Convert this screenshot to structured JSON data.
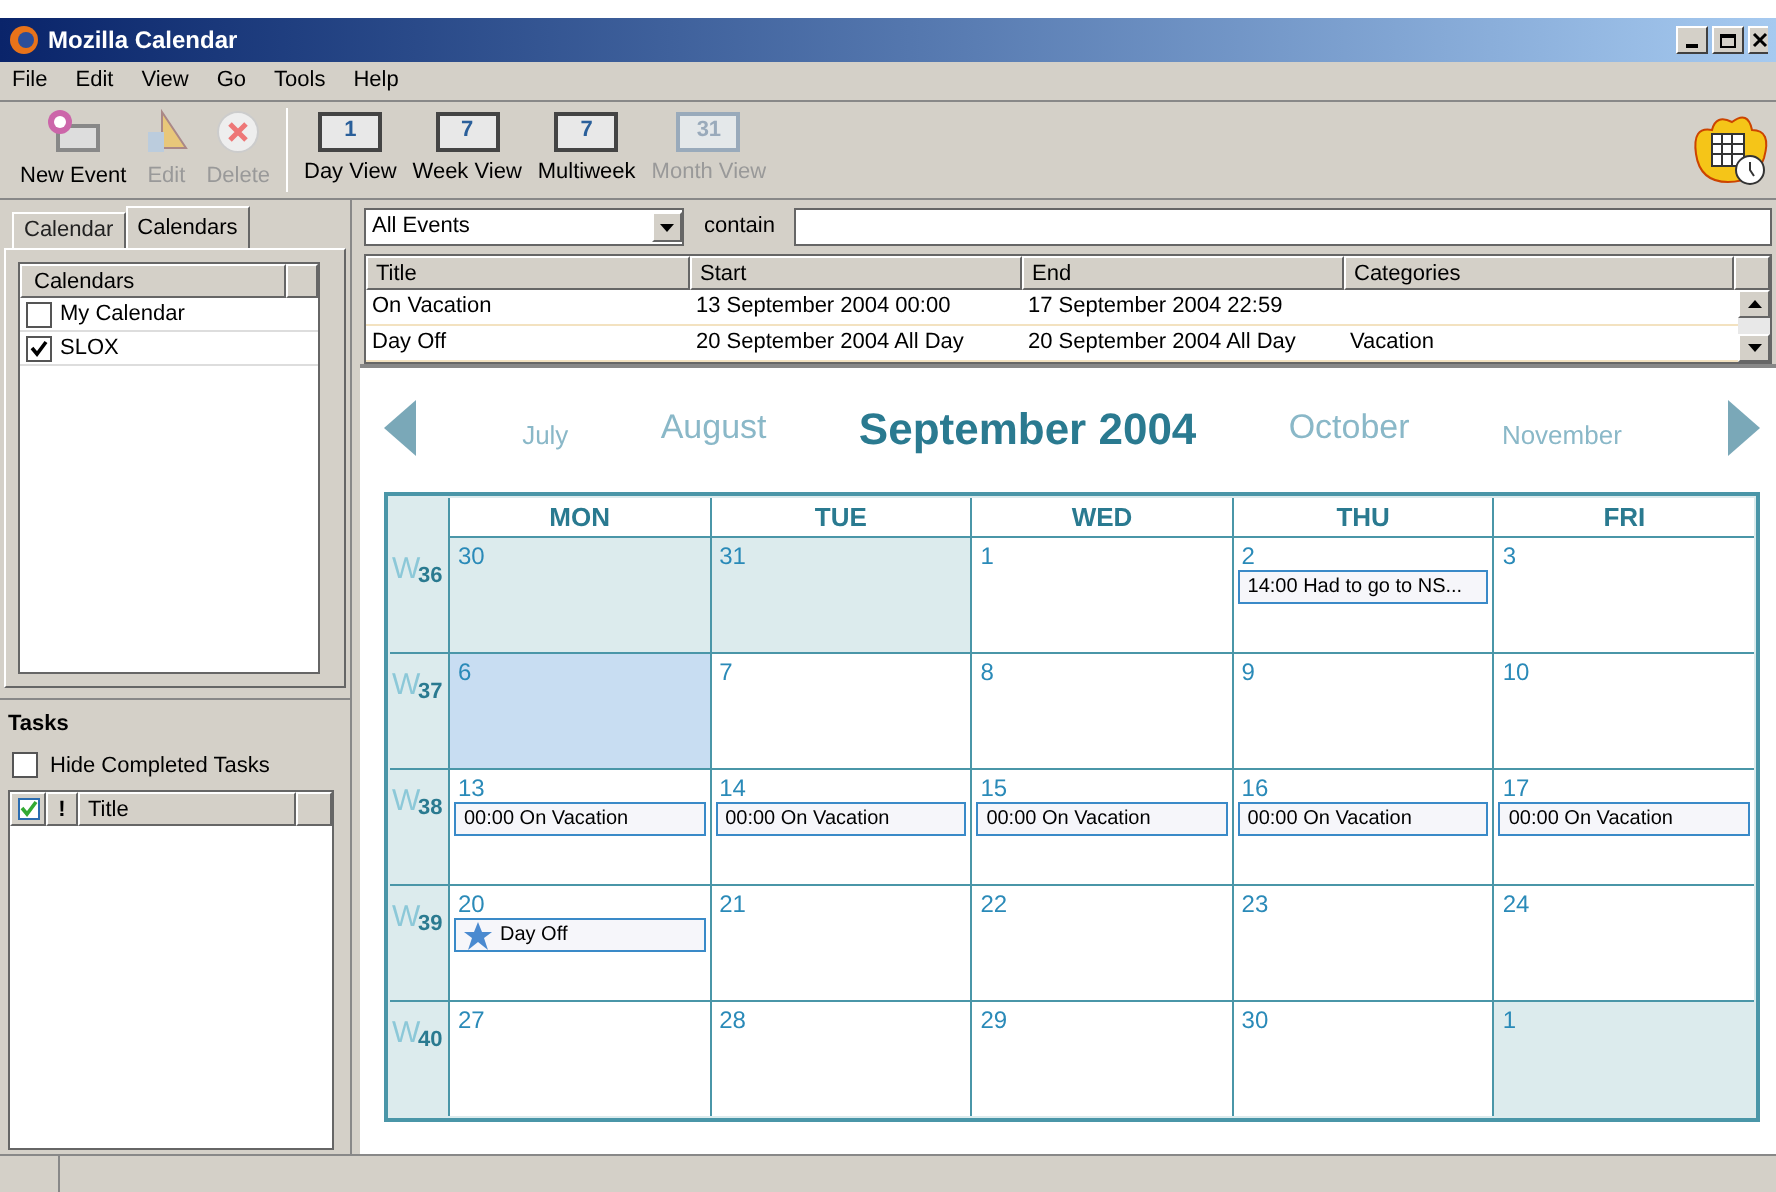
{
  "window": {
    "title": "Mozilla Calendar"
  },
  "menu": [
    "File",
    "Edit",
    "View",
    "Go",
    "Tools",
    "Help"
  ],
  "toolbar": [
    {
      "label": "New Event",
      "kind": "new",
      "disabled": false
    },
    {
      "label": "Edit",
      "kind": "edit",
      "disabled": true
    },
    {
      "label": "Delete",
      "kind": "delete",
      "disabled": true
    },
    {
      "label": "Day View",
      "kind": "day",
      "disabled": false,
      "glyph": "1"
    },
    {
      "label": "Week View",
      "kind": "week",
      "disabled": false,
      "glyph": "7"
    },
    {
      "label": "Multiweek",
      "kind": "multi",
      "disabled": false,
      "glyph": "7"
    },
    {
      "label": "Month View",
      "kind": "month",
      "disabled": true,
      "glyph": "31"
    }
  ],
  "sidebar": {
    "tabs": [
      {
        "label": "Calendar",
        "selected": false
      },
      {
        "label": "Calendars",
        "selected": true
      }
    ],
    "calendars_header": "Calendars",
    "calendars": [
      {
        "name": "My Calendar",
        "checked": false
      },
      {
        "name": "SLOX",
        "checked": true
      }
    ],
    "tasks": {
      "title": "Tasks",
      "hide_completed": {
        "label": "Hide Completed Tasks",
        "checked": false
      },
      "columns": [
        "!",
        "Title"
      ]
    }
  },
  "filter": {
    "value": "All Events",
    "contain_label": "contain"
  },
  "event_list": {
    "columns": [
      "Title",
      "Start",
      "End",
      "Categories"
    ],
    "rows": [
      {
        "title": "On Vacation",
        "start": "13 September 2004 00:00",
        "end": "17 September 2004 22:59"
      },
      {
        "title": "Day Off",
        "start": "20 September 2004 All Day",
        "end": "20 September 2004 All Day",
        "categories": "Vacation"
      }
    ]
  },
  "month_nav": [
    {
      "label": "July",
      "kind": "far"
    },
    {
      "label": "August",
      "kind": "near"
    },
    {
      "label": "September 2004",
      "kind": "current"
    },
    {
      "label": "October",
      "kind": "near"
    },
    {
      "label": "November",
      "kind": "far"
    }
  ],
  "month": {
    "days_of_week": [
      "MON",
      "TUE",
      "WED",
      "THU",
      "FRI"
    ],
    "weeks": [
      {
        "letter": "W",
        "number": "36",
        "days": [
          {
            "day": "30",
            "other_month": true,
            "selected": false
          },
          {
            "day": "31",
            "other_month": true,
            "selected": false
          },
          {
            "day": "1",
            "other_month": false,
            "selected": false
          },
          {
            "day": "2",
            "other_month": false,
            "selected": false,
            "events": [
              {
                "text": "14:00 Had to go to NS...",
                "kind": "timed"
              }
            ]
          },
          {
            "day": "3",
            "other_month": false,
            "selected": false
          }
        ]
      },
      {
        "letter": "W",
        "number": "37",
        "days": [
          {
            "day": "6",
            "other_month": false,
            "selected": true
          },
          {
            "day": "7",
            "other_month": false,
            "selected": false
          },
          {
            "day": "8",
            "other_month": false,
            "selected": false
          },
          {
            "day": "9",
            "other_month": false,
            "selected": false
          },
          {
            "day": "10",
            "other_month": false,
            "selected": false
          }
        ]
      },
      {
        "letter": "W",
        "number": "38",
        "days": [
          {
            "day": "13",
            "other_month": false,
            "selected": false,
            "events": [
              {
                "text": "00:00 On Vacation",
                "kind": "timed"
              }
            ]
          },
          {
            "day": "14",
            "other_month": false,
            "selected": false,
            "events": [
              {
                "text": "00:00 On Vacation",
                "kind": "timed"
              }
            ]
          },
          {
            "day": "15",
            "other_month": false,
            "selected": false,
            "events": [
              {
                "text": "00:00 On Vacation",
                "kind": "timed"
              }
            ]
          },
          {
            "day": "16",
            "other_month": false,
            "selected": false,
            "events": [
              {
                "text": "00:00 On Vacation",
                "kind": "timed"
              }
            ]
          },
          {
            "day": "17",
            "other_month": false,
            "selected": false,
            "events": [
              {
                "text": "00:00 On Vacation",
                "kind": "timed"
              }
            ]
          }
        ]
      },
      {
        "letter": "W",
        "number": "39",
        "days": [
          {
            "day": "20",
            "other_month": false,
            "selected": false,
            "events": [
              {
                "text": "Day Off",
                "kind": "all_day"
              }
            ]
          },
          {
            "day": "21",
            "other_month": false,
            "selected": false
          },
          {
            "day": "22",
            "other_month": false,
            "selected": false
          },
          {
            "day": "23",
            "other_month": false,
            "selected": false
          },
          {
            "day": "24",
            "other_month": false,
            "selected": false
          }
        ]
      },
      {
        "letter": "W",
        "number": "40",
        "days": [
          {
            "day": "27",
            "other_month": false,
            "selected": false
          },
          {
            "day": "28",
            "other_month": false,
            "selected": false
          },
          {
            "day": "29",
            "other_month": false,
            "selected": false
          },
          {
            "day": "30",
            "other_month": false,
            "selected": false
          },
          {
            "day": "1",
            "other_month": true,
            "selected": false
          }
        ]
      }
    ]
  }
}
